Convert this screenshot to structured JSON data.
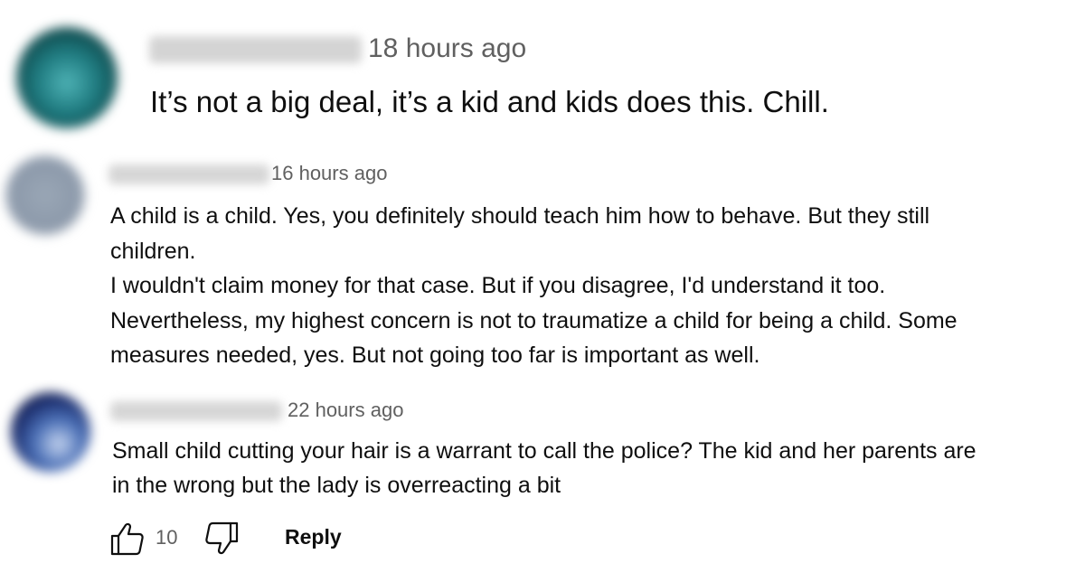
{
  "comments": [
    {
      "time": "18 hours ago",
      "lines": [
        "It’s not a big deal, it’s a kid and kids does this. Chill."
      ]
    },
    {
      "time": "16 hours ago",
      "lines": [
        "A child is a child. Yes, you definitely should teach him how to behave. But they still",
        "children.",
        "I wouldn't claim money for that case. But if you disagree, I'd understand it too.",
        "Nevertheless, my highest concern is not to traumatize a child for being a child. Some",
        "measures needed, yes. But not going too far is important as well."
      ]
    },
    {
      "time": "22 hours ago",
      "lines": [
        "Small child cutting your hair is a warrant to call the police? The kid and her parents are",
        "in the wrong but the lady is overreacting a bit"
      ]
    }
  ],
  "actions": {
    "like_count": "10",
    "reply_label": "Reply",
    "like_icon": "thumbs-up-icon",
    "dislike_icon": "thumbs-down-icon"
  }
}
